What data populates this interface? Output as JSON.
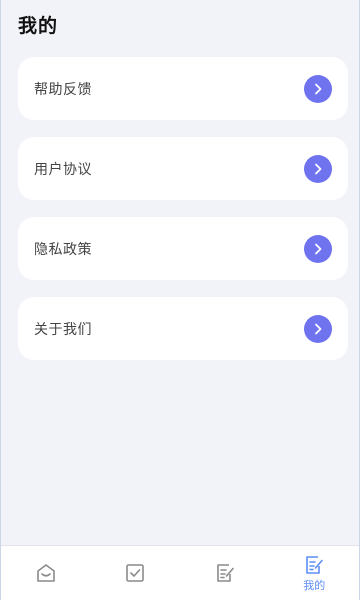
{
  "header": {
    "title": "我的"
  },
  "menu": {
    "items": [
      {
        "label": "帮助反馈",
        "icon": "chevron-right-icon"
      },
      {
        "label": "用户协议",
        "icon": "chevron-right-icon"
      },
      {
        "label": "隐私政策",
        "icon": "chevron-right-icon"
      },
      {
        "label": "关于我们",
        "icon": "chevron-right-icon"
      }
    ]
  },
  "tabbar": {
    "tabs": [
      {
        "icon": "home-icon",
        "label": "",
        "active": false
      },
      {
        "icon": "checkbox-icon",
        "label": "",
        "active": false
      },
      {
        "icon": "edit-note-icon",
        "label": "",
        "active": false
      },
      {
        "icon": "profile-edit-icon",
        "label": "我的",
        "active": true
      }
    ]
  },
  "colors": {
    "accent": "#6f73ee",
    "active_tab": "#5d8df6",
    "inactive_icon": "#8a8a8a",
    "background": "#f2f3f8"
  }
}
